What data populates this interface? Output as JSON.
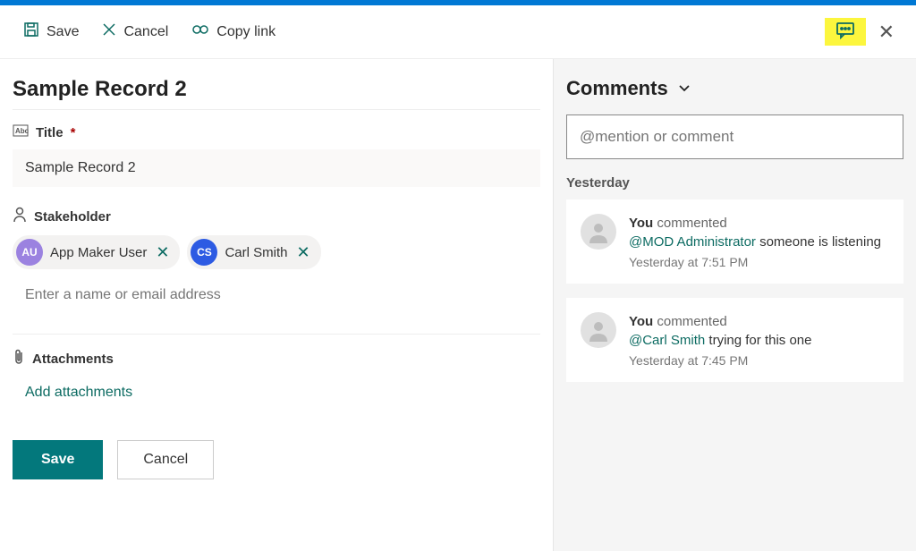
{
  "toolbar": {
    "save": "Save",
    "cancel": "Cancel",
    "copyLink": "Copy link"
  },
  "pageTitle": "Sample Record 2",
  "fields": {
    "title": {
      "label": "Title",
      "required": "*",
      "value": "Sample Record 2"
    },
    "stakeholder": {
      "label": "Stakeholder",
      "chips": [
        {
          "initials": "AU",
          "name": "App Maker User"
        },
        {
          "initials": "CS",
          "name": "Carl Smith"
        }
      ],
      "placeholder": "Enter a name or email address"
    },
    "attachments": {
      "label": "Attachments",
      "addLabel": "Add attachments"
    }
  },
  "bottom": {
    "save": "Save",
    "cancel": "Cancel"
  },
  "comments": {
    "heading": "Comments",
    "placeholder": "@mention or comment",
    "groupLabel": "Yesterday",
    "items": [
      {
        "author": "You",
        "verb": "commented",
        "mention": "@MOD Administrator",
        "text": "someone is listening",
        "time": "Yesterday at 7:51 PM"
      },
      {
        "author": "You",
        "verb": "commented",
        "mention": "@Carl Smith",
        "text": "trying for this one",
        "time": "Yesterday at 7:45 PM"
      }
    ]
  }
}
